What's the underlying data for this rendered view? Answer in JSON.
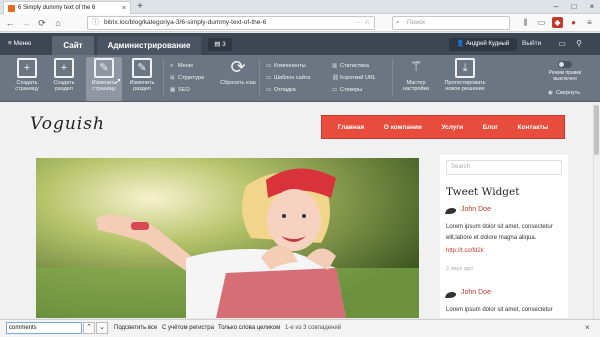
{
  "browser": {
    "tab_title": "6 Simply dummy text of the 6",
    "url": "bitrix.loc/blog/kategoriya-3/6-simply-dummy-text-of-the-6",
    "search_placeholder": "Поиск"
  },
  "admin_bar": {
    "menu_label": "Меню",
    "tab_site": "Сайт",
    "tab_admin": "Администрирование",
    "notifications_count": "3",
    "user_name": "Андрей Кудный",
    "logout_label": "Выйти"
  },
  "toolbar": {
    "create_page": "Создать страницу",
    "create_section": "Создать раздел",
    "edit_page": "Изменить страницу",
    "edit_section": "Изменить раздел",
    "menu": "Меню",
    "structure": "Структура",
    "seo": "SEO",
    "reset_cache": "Сбросить кэш",
    "components": "Компоненты",
    "site_template": "Шаблон сайта",
    "debug": "Отладка",
    "statistics": "Статистика",
    "short_url": "Короткий URL",
    "stickers": "Стикеры",
    "master_setup": "Мастер настройки",
    "test_new_solution": "Протестировать новое решение",
    "edit_mode": "Режим правки выключен",
    "collapse": "Свернуть"
  },
  "site": {
    "logo": "Voguish",
    "nav": [
      "Главная",
      "О компании",
      "Услуги",
      "Блог",
      "Контакты"
    ],
    "sidebar": {
      "search_placeholder": "Search",
      "widget_title": "Tweet Widget",
      "tweets": [
        {
          "user": "John Doe",
          "text": "Lorem ipsum dolor sit amet, consectetur elit,labore et dolore magna aliqua.",
          "link": "http://t.co/fd2k",
          "date": "2 days ago"
        },
        {
          "user": "John Doe",
          "text": "Lorem ipsum dolor sit amet, consectetur"
        }
      ]
    }
  },
  "findbar": {
    "query": "comments",
    "highlight_all": "Подсветить все",
    "match_case": "С учётом регистра",
    "whole_words": "Только слова целиком",
    "result": "1-е из 3 совпадений"
  },
  "colors": {
    "admin_dark": "#3d4653",
    "admin_panel": "#6c7683",
    "accent_red": "#e84c3d"
  }
}
